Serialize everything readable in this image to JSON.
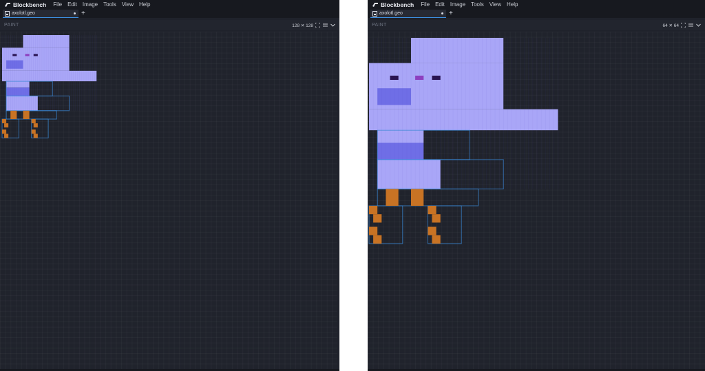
{
  "left": {
    "app_name": "Blockbench",
    "menu": [
      "File",
      "Edit",
      "Image",
      "Tools",
      "View",
      "Help"
    ],
    "tab_label": "axolotl.geo",
    "panel_title": "PAINT",
    "resolution": "128 ✕ 128",
    "icons": [
      "blockbench-logo-icon",
      "file-icon",
      "add-tab-icon",
      "fullscreen-icon",
      "menu-lines-icon",
      "chevron-down-icon"
    ]
  },
  "right": {
    "app_name": "Blockbench",
    "menu": [
      "File",
      "Edit",
      "Image",
      "Tools",
      "View",
      "Help"
    ],
    "tab_label": "axolotl.geo",
    "panel_title": "PAINT",
    "resolution": "64 ✕ 64",
    "icons": [
      "blockbench-logo-icon",
      "file-icon",
      "add-tab-icon",
      "fullscreen-icon",
      "menu-lines-icon",
      "chevron-down-icon"
    ]
  },
  "colors": {
    "axolotl_body": "#a9a6f7",
    "axolotl_dark": "#6f6ee6",
    "eye": "#2a1452",
    "legs": "#c87324",
    "accent": "#3c8fe0"
  }
}
